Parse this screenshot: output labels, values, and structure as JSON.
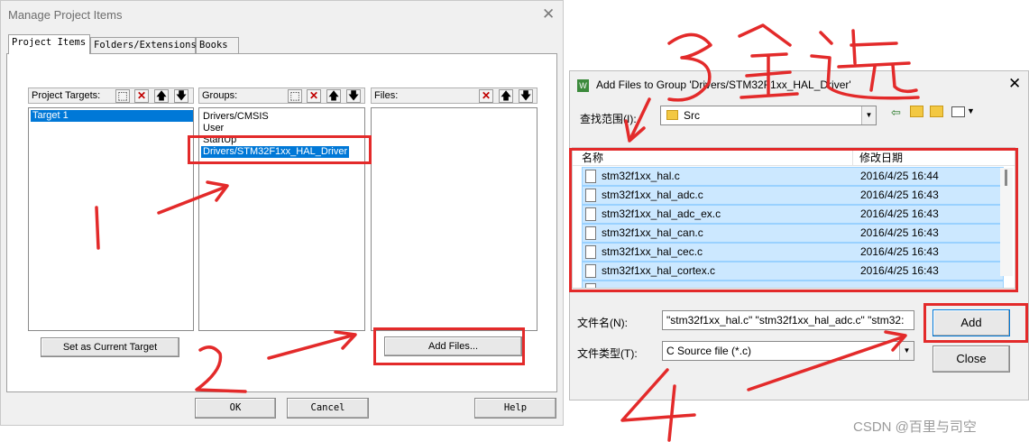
{
  "manage_dialog": {
    "title": "Manage Project Items",
    "tabs": [
      "Project Items",
      "Folders/Extensions",
      "Books"
    ],
    "targets_label": "Project Targets:",
    "groups_label": "Groups:",
    "files_label": "Files:",
    "targets": [
      "Target 1"
    ],
    "groups": [
      "Drivers/CMSIS",
      "User",
      "StartUp",
      "Drivers/STM32F1xx_HAL_Driver"
    ],
    "selected_group_index": 3,
    "set_current_label": "Set as Current Target",
    "add_files_label": "Add Files...",
    "ok_label": "OK",
    "cancel_label": "Cancel",
    "help_label": "Help"
  },
  "add_files_dialog": {
    "title": "Add Files to Group 'Drivers/STM32F1xx_HAL_Driver'",
    "look_in_label": "查找范围(I):",
    "look_in_value": "Src",
    "col_name": "名称",
    "col_date": "修改日期",
    "files": [
      {
        "name": "stm32f1xx_hal.c",
        "date": "2016/4/25 16:44"
      },
      {
        "name": "stm32f1xx_hal_adc.c",
        "date": "2016/4/25 16:43"
      },
      {
        "name": "stm32f1xx_hal_adc_ex.c",
        "date": "2016/4/25 16:43"
      },
      {
        "name": "stm32f1xx_hal_can.c",
        "date": "2016/4/25 16:43"
      },
      {
        "name": "stm32f1xx_hal_cec.c",
        "date": "2016/4/25 16:43"
      },
      {
        "name": "stm32f1xx_hal_cortex.c",
        "date": "2016/4/25 16:43"
      }
    ],
    "filename_label": "文件名(N):",
    "filename_value": "\"stm32f1xx_hal.c\" \"stm32f1xx_hal_adc.c\" \"stm32:",
    "filetype_label": "文件类型(T):",
    "filetype_value": "C Source file (*.c)",
    "add_label": "Add",
    "close_label": "Close"
  },
  "annotations": {
    "step1": "1",
    "step2": "2",
    "step3": "3 全选",
    "step4": "4",
    "color": "#e32a2a"
  },
  "watermark": "CSDN @百里与司空"
}
